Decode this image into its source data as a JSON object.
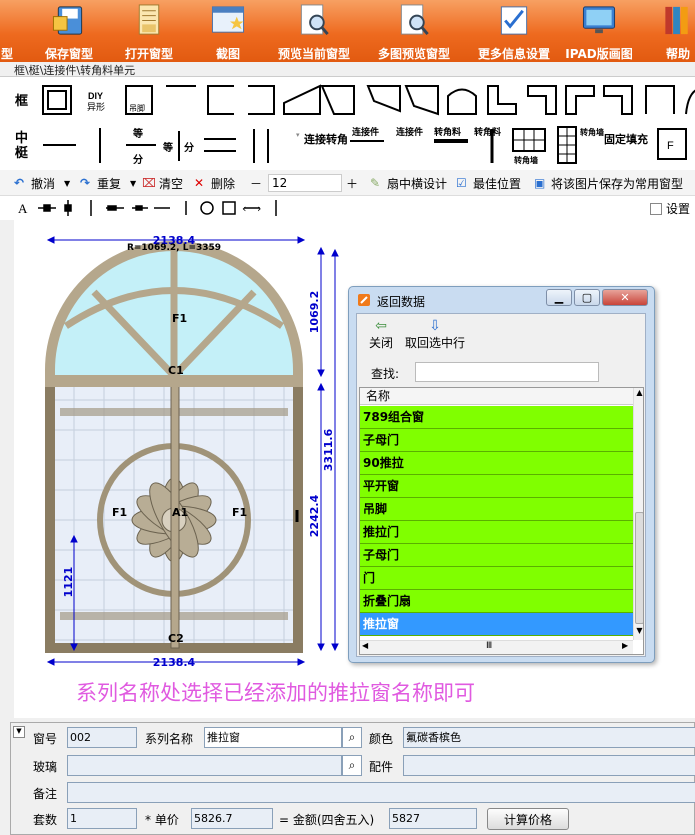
{
  "ribbon": {
    "items": [
      {
        "label": "型",
        "icon": "window-icon"
      },
      {
        "label": "保存窗型",
        "icon": "save-icon"
      },
      {
        "label": "打开窗型",
        "icon": "open-icon"
      },
      {
        "label": "截图",
        "icon": "screenshot-icon"
      },
      {
        "label": "预览当前窗型",
        "icon": "preview-icon"
      },
      {
        "label": "多图预览窗型",
        "icon": "multi-preview-icon"
      },
      {
        "label": "更多信息设置",
        "icon": "settings-icon"
      },
      {
        "label": "IPAD版画图",
        "icon": "ipad-icon"
      },
      {
        "label": "帮助",
        "icon": "help-icon"
      }
    ]
  },
  "breadcrumb": "框\\梃\\连接件\\转角料单元",
  "parts": {
    "frame_label": "框",
    "mullion_label": "中梃",
    "diy_label": "DIY",
    "diy_sub": "异形",
    "hinge_label": "吊脚",
    "equal_label": "等分",
    "equal_word": "等",
    "fen_word": "分",
    "connector_turn": "连接转角",
    "connector": "连接件",
    "connector_vert": "连接件",
    "corner_bar": "转角料",
    "corner_bar_vert": "转角料",
    "corner_wall": "转角墙",
    "corner_wall_vert": "转角墙",
    "fixed_fill": "固定填充",
    "f_label": "F"
  },
  "toolbar": {
    "undo": "撤消",
    "redo": "重复",
    "clear": "清空",
    "delete": "删除",
    "minus": "－",
    "size_value": "12",
    "plus": "＋",
    "sash_design": "扇中横设计",
    "best_position": "最佳位置",
    "save_common": "将该图片保存为常用窗型"
  },
  "toolbar2": {
    "text_tool": "A",
    "settings_checkbox": "设置"
  },
  "drawing": {
    "top_width": "2138.4",
    "bottom_width": "2138.4",
    "radius_note": "R=1069.2, L=3359",
    "arch_height": "1069.2",
    "total_height": "3311.6",
    "rect_height": "2242.4",
    "left_height": "1121",
    "tag_f1_top": "F1",
    "tag_c1": "C1",
    "tag_f1_left": "F1",
    "tag_a1": "A1",
    "tag_f1_right": "F1",
    "tag_c2": "C2"
  },
  "caption": "系列名称处选择已经添加的推拉窗名称即可",
  "dialog": {
    "title": "返回数据",
    "close_label": "关闭",
    "back_label": "取回选中行",
    "find_label": "查找:",
    "find_value": "",
    "column_header": "名称",
    "rows": [
      "789组合窗",
      "子母门",
      "90推拉",
      "平开窗",
      "吊脚",
      "推拉门",
      "子母门",
      "门",
      "折叠门扇",
      "推拉窗"
    ],
    "selected_index": 9,
    "scroll_arrow": "Ⅲ"
  },
  "form": {
    "window_no_label": "窗号",
    "window_no": "002",
    "series_label": "系列名称",
    "series_value": "推拉窗",
    "color_label": "颜色",
    "color_value": "氟碳香槟色",
    "glass_label": "玻璃",
    "glass_value": "",
    "accessory_label": "配件",
    "accessory_value": "",
    "note_label": "备注",
    "note_value": "",
    "sets_label": "套数",
    "sets_value": "1",
    "unit_price_label": "* 单价",
    "unit_price": "5826.7",
    "amount_label": "= 金额(四舍五入)",
    "amount": "5827",
    "calc_button": "计算价格"
  },
  "colors": {
    "ribbon_orange": "#ee6a1f",
    "row_green": "#80ff00",
    "row_selected": "#3399ff",
    "caption_magenta": "#e05ae0",
    "dimension_blue": "#0000cc",
    "frame_tan": "#b5a78c"
  }
}
